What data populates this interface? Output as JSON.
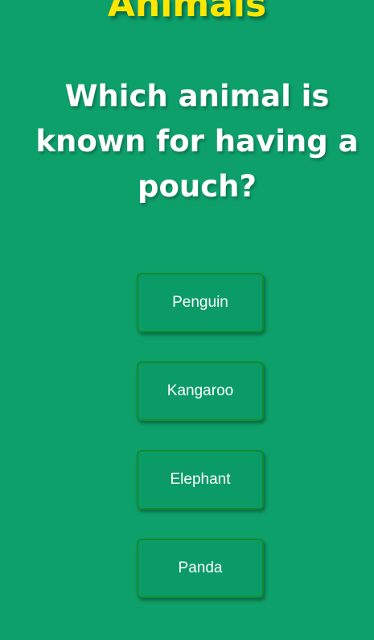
{
  "quiz": {
    "category_title": "Animals",
    "question": "Which animal is known for having a pouch?",
    "answers": [
      "Penguin",
      "Kangaroo",
      "Elephant",
      "Panda"
    ]
  },
  "colors": {
    "background": "#0ea06b",
    "title": "#ffe600",
    "button_border": "#128a2e",
    "text": "#ffffff"
  }
}
